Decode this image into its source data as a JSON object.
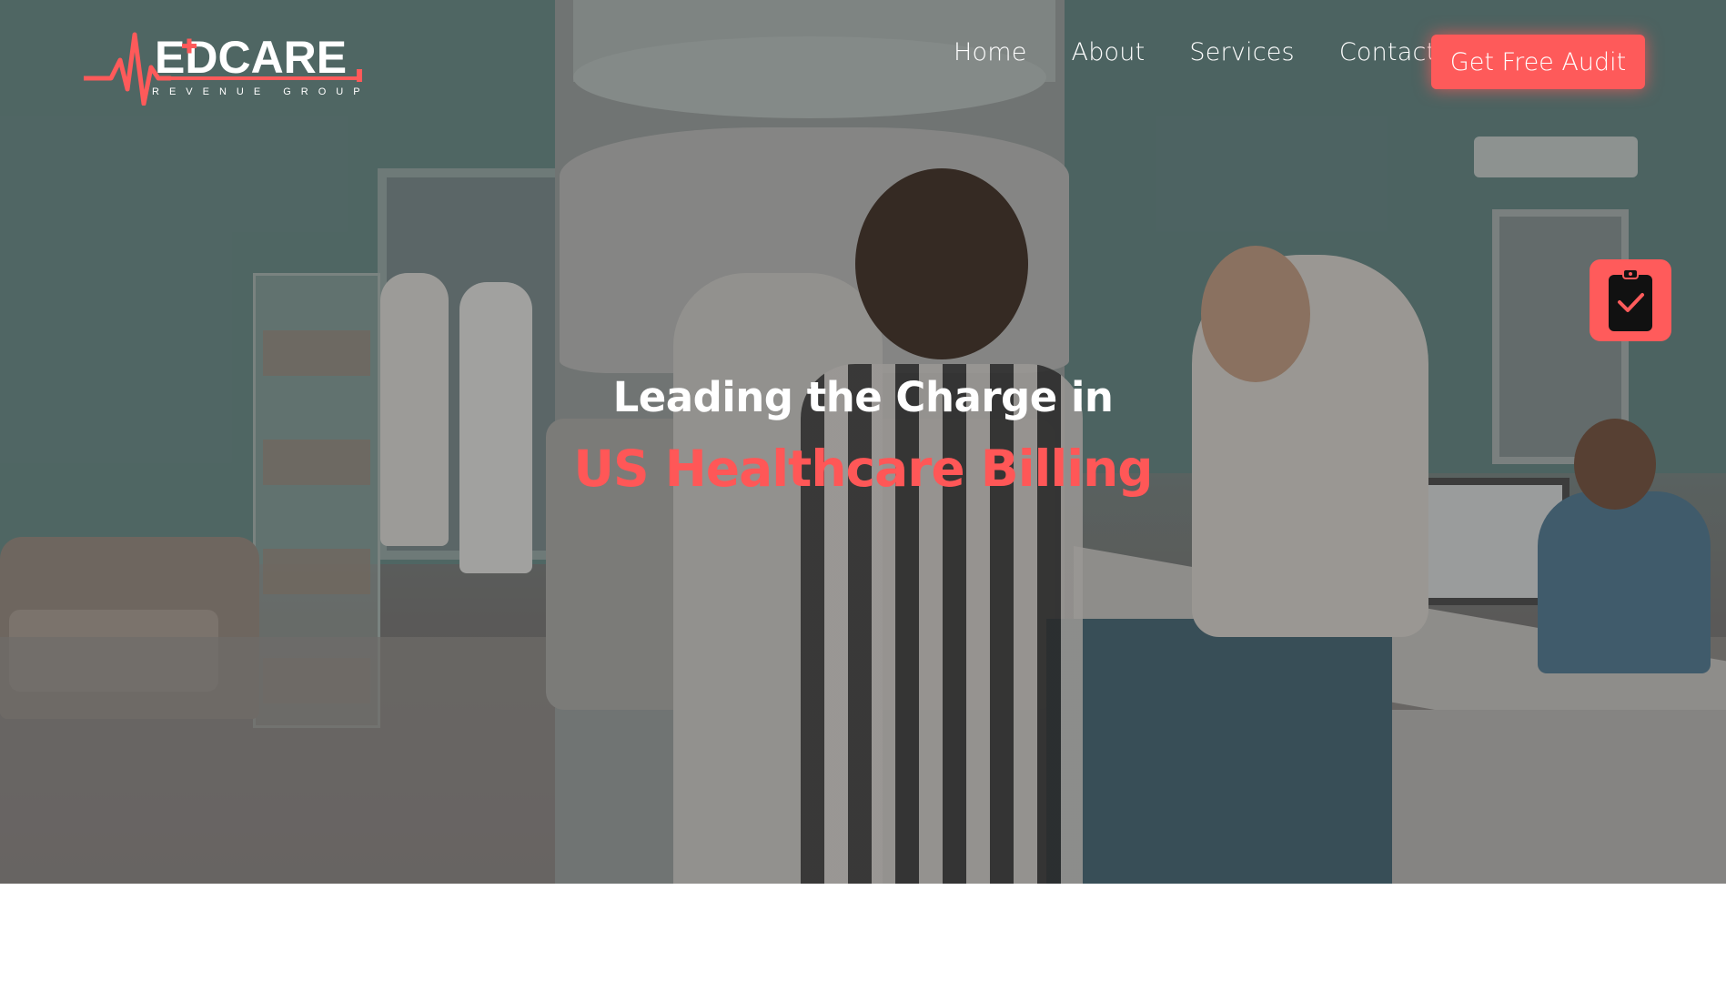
{
  "brand": {
    "name_prefix": "M",
    "name_main": "EDCARE",
    "tagline": "REVENUE GROUP",
    "accent": "#fe5a5a",
    "text_color": "#ffffff"
  },
  "nav": {
    "items": [
      {
        "label": "Home"
      },
      {
        "label": "About"
      },
      {
        "label": "Services"
      },
      {
        "label": "Contact"
      }
    ],
    "cta_label": "Get Free Audit"
  },
  "hero": {
    "line1": "Leading the Charge in",
    "line2": "US Healthcare Billing",
    "line2_color": "#ff5757"
  },
  "floating_action": {
    "icon": "clipboard-check-icon",
    "color": "#ff5b5b"
  }
}
